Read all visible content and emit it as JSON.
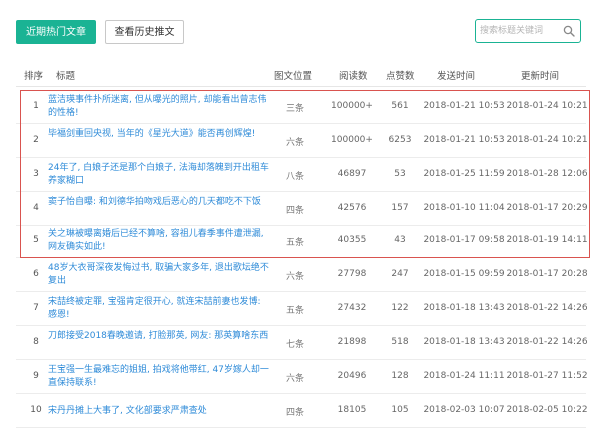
{
  "toolbar": {
    "recent_hot_label": "近期热门文章",
    "history_label": "查看历史推文",
    "search_placeholder": "搜索标题关键词"
  },
  "table": {
    "headers": {
      "index": "排序",
      "title": "标题",
      "position": "图文位置",
      "reads": "阅读数",
      "likes": "点赞数",
      "publish_time": "发送时间",
      "update_time": "更新时间"
    },
    "rows": [
      {
        "index": "1",
        "title": "蓝洁瑛事件扑所迷离, 但从曝光的照片, 却能看出曾志伟的性格!",
        "position": "三条",
        "reads": "100000+",
        "likes": "561",
        "publish_time": "2018-01-21 10:53",
        "update_time": "2018-01-24 10:21"
      },
      {
        "index": "2",
        "title": "毕福剑重回央视, 当年的《星光大道》能否再创辉煌!",
        "position": "六条",
        "reads": "100000+",
        "likes": "6253",
        "publish_time": "2018-01-21 10:53",
        "update_time": "2018-01-24 10:21"
      },
      {
        "index": "3",
        "title": "24年了, 白娘子还是那个白娘子, 法海却落魄到开出租车养家糊口",
        "position": "八条",
        "reads": "46897",
        "likes": "53",
        "publish_time": "2018-01-25 11:59",
        "update_time": "2018-01-28 12:06"
      },
      {
        "index": "4",
        "title": "窦子怡自曝: 和刘德华拍吻戏后恶心的几天都吃不下饭",
        "position": "四条",
        "reads": "42576",
        "likes": "157",
        "publish_time": "2018-01-10 11:04",
        "update_time": "2018-01-17 20:29"
      },
      {
        "index": "5",
        "title": "关之琳被曝离婚后已经不算啥, 容祖儿春季事件遭泄漏, 网友确实如此!",
        "position": "五条",
        "reads": "40355",
        "likes": "43",
        "publish_time": "2018-01-17 09:58",
        "update_time": "2018-01-19 14:11"
      },
      {
        "index": "6",
        "title": "48岁大衣哥深夜发悔过书, 取骗大家多年, 退出歌坛绝不复出",
        "position": "六条",
        "reads": "27798",
        "likes": "247",
        "publish_time": "2018-01-15 09:59",
        "update_time": "2018-01-17 20:28"
      },
      {
        "index": "7",
        "title": "宋喆终被定罪, 宝强肯定很开心, 就连宋喆前妻也发博: 感恩!",
        "position": "五条",
        "reads": "27432",
        "likes": "122",
        "publish_time": "2018-01-18 13:43",
        "update_time": "2018-01-22 14:26"
      },
      {
        "index": "8",
        "title": "刀郎接受2018春晚邀请, 打脸那英, 网友: 那英算啥东西",
        "position": "七条",
        "reads": "21898",
        "likes": "518",
        "publish_time": "2018-01-18 13:43",
        "update_time": "2018-01-22 14:26"
      },
      {
        "index": "9",
        "title": "王宝强一生最难忘的姐姐, 拍戏将他带红, 47岁嫁人却一直保持联系!",
        "position": "六条",
        "reads": "20496",
        "likes": "128",
        "publish_time": "2018-01-24 11:11",
        "update_time": "2018-01-27 11:52"
      },
      {
        "index": "10",
        "title": "宋丹丹摊上大事了, 文化部要求严肃查处",
        "position": "四条",
        "reads": "18105",
        "likes": "105",
        "publish_time": "2018-02-03 10:07",
        "update_time": "2018-02-05 10:22"
      }
    ]
  },
  "colors": {
    "primary": "#1ab394",
    "link": "#2f8bd8",
    "highlight": "#d9534f"
  }
}
